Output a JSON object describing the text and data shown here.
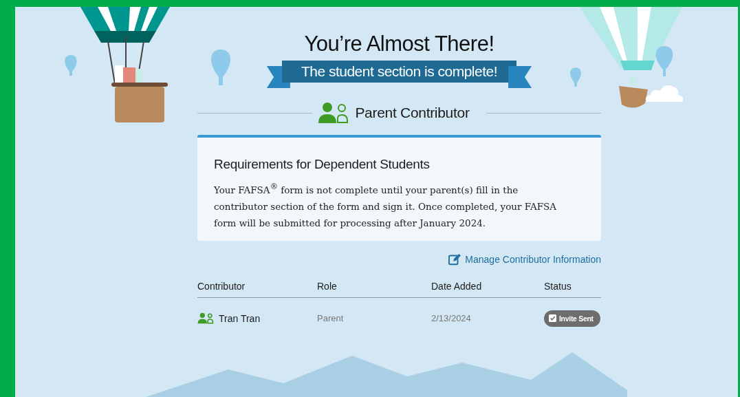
{
  "title": "You’re Almost There!",
  "banner": "The student section is complete!",
  "section": {
    "title": "Parent Contributor"
  },
  "card": {
    "heading": "Requirements for Dependent Students",
    "body": "Your FAFSA$^{®}$ form is not complete until your parent(s) fill in the contributor section of the form and sign it. Once completed, your FAFSA form will be submitted for processing after January 2024."
  },
  "manage_link": "Manage Contributor Information",
  "table": {
    "columns": [
      "Contributor",
      "Role",
      "Date Added",
      "Status"
    ],
    "rows": [
      {
        "contributor": "Tran Tran",
        "role": "Parent",
        "date_added": "2/13/2024",
        "status": "Invite Sent"
      }
    ]
  }
}
